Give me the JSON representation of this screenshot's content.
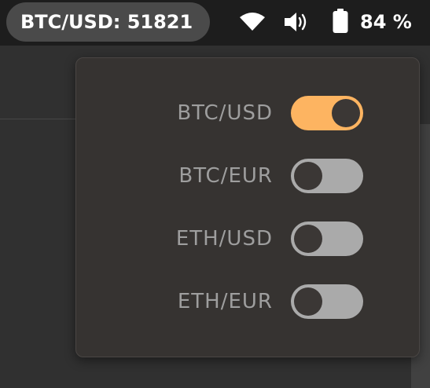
{
  "topbar": {
    "ticker_label": "BTC/USD: 51821",
    "battery_percent": "84 %",
    "icons": [
      "wifi-icon",
      "volume-icon",
      "battery-icon"
    ]
  },
  "menu": {
    "pairs": [
      {
        "label": "BTC/USD",
        "enabled": true
      },
      {
        "label": "BTC/EUR",
        "enabled": false
      },
      {
        "label": "ETH/USD",
        "enabled": false
      },
      {
        "label": "ETH/EUR",
        "enabled": false
      }
    ]
  },
  "colors": {
    "accent": "#fdb461",
    "toggle_off": "#aaaaaa",
    "popover_bg": "#363331",
    "topbar_bg": "#1d1d1d"
  }
}
